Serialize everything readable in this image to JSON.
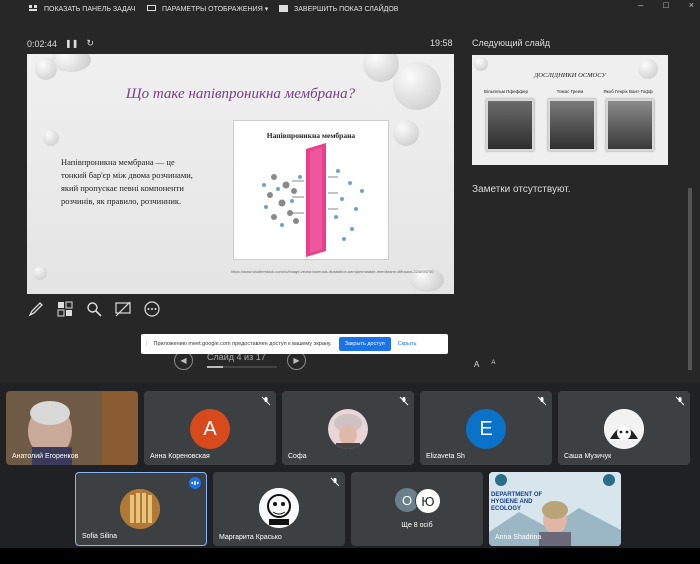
{
  "toolbar": {
    "taskbar_label": "ПОКАЗАТЬ ПАНЕЛЬ ЗАДАЧ",
    "display_label": "ПАРАМЕТРЫ ОТОБРАЖЕНИЯ ▾",
    "end_label": "ЗАВЕРШИТЬ ПОКАЗ СЛАЙДОВ",
    "minimize": "–",
    "maximize": "□",
    "close": "×"
  },
  "presenter": {
    "elapsed": "0:02:44",
    "clock": "19:58",
    "next_slide_label": "Следующий слайд",
    "notes": "Заметки отсутствуют.",
    "slide_counter": "Слайд 4 из 17",
    "font_up": "A",
    "font_down": "A"
  },
  "slide": {
    "title": "Що таке напівпроникна мембрана?",
    "body": "Напівпроникна мембрана — це тонкий бар'єр між двома розчинами, який пропускає певні компоненти розчинів, як правило, розчинник.",
    "figure_title": "Напівпроникна мембрана",
    "source": "https://www.shutterstock.com/ru/image-vector/osmosis-illustration-semipermeable-membrane-diffusion-224093740"
  },
  "next_slide": {
    "title": "ДОСЛІДНИКИ ОСМОСУ",
    "names": [
      "Вільгельм Пфеффер",
      "Томас Греем",
      "Якоб Генріх Вант-Гофф"
    ]
  },
  "share_banner": {
    "text": "Приложению meet.google.com предоставлен доступ к вашему экрану.",
    "stop_button": "Закрыть доступ",
    "hide_link": "Скрыть"
  },
  "participants": [
    {
      "name": "Анатолий Егоренков"
    },
    {
      "name": "Анна Кореновская",
      "initial": "А",
      "color": "#d84a1b"
    },
    {
      "name": "Софа"
    },
    {
      "name": "Elizaveta Sh",
      "initial": "E",
      "color": "#0b72c9"
    },
    {
      "name": "Саша Музичук"
    },
    {
      "name": "Sofia Silina"
    },
    {
      "name": "Маргарита Красько"
    },
    {
      "name": "Ще 8 осіб",
      "initial1": "О",
      "initial2": "Ю"
    },
    {
      "name": "Anna Shadrina",
      "logo_line1": "DEPARTMENT OF",
      "logo_line2": "HYGIENE AND",
      "logo_line3": "ECOLOGY"
    }
  ]
}
